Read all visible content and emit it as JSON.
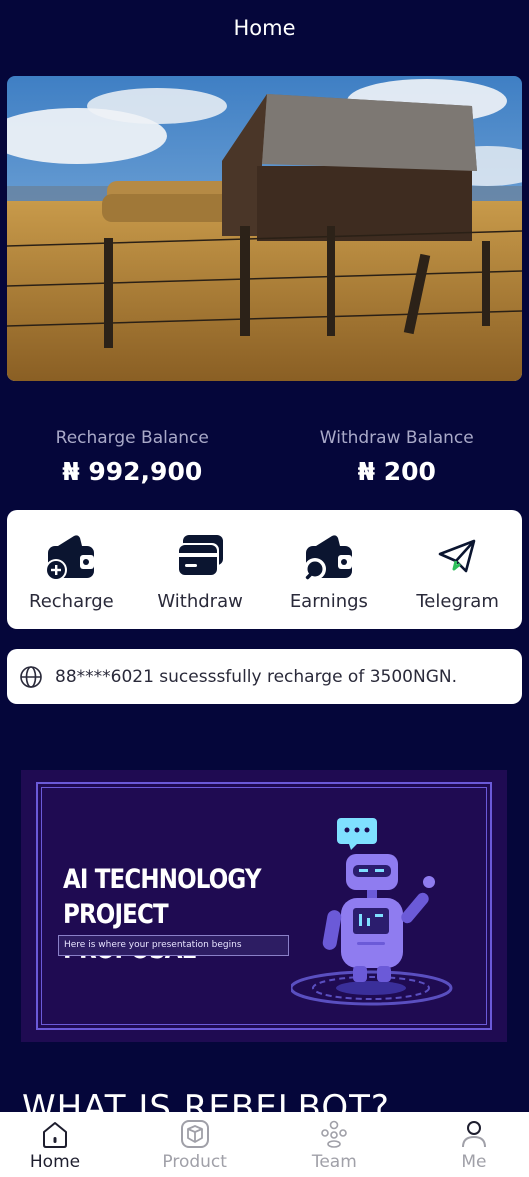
{
  "header": {
    "title": "Home"
  },
  "balances": [
    {
      "label": "Recharge Balance",
      "amount": "₦ 992,900"
    },
    {
      "label": "Withdraw Balance",
      "amount": "₦ 200"
    }
  ],
  "actions": [
    {
      "label": "Recharge",
      "icon": "wallet-plus-icon"
    },
    {
      "label": "Withdraw",
      "icon": "card-icon"
    },
    {
      "label": "Earnings",
      "icon": "wallet-search-icon"
    },
    {
      "label": "Telegram",
      "icon": "telegram-icon"
    }
  ],
  "notice": {
    "text": "88****6021 sucesssfully recharge of 3500NGN.",
    "icon": "globe-icon"
  },
  "promo": {
    "title_line1": "AI TECHNOLOGY",
    "title_line2": "PROJECT PROPOSAL",
    "subtitle": "Here is where your presentation begins"
  },
  "section": {
    "heading": "WHAT IS REBELBOT?"
  },
  "tabbar": [
    {
      "label": "Home",
      "icon": "home-icon",
      "active": true
    },
    {
      "label": "Product",
      "icon": "box-icon",
      "active": false
    },
    {
      "label": "Team",
      "icon": "team-icon",
      "active": false
    },
    {
      "label": "Me",
      "icon": "user-icon",
      "active": false
    }
  ],
  "colors": {
    "background": "#05063a",
    "card": "#ffffff",
    "promo_bg": "#1f0b52",
    "accent": "#6b5ad8"
  }
}
